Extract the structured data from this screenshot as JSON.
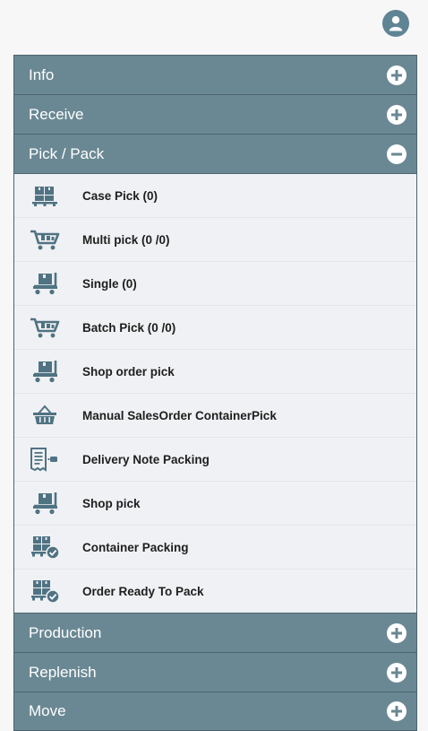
{
  "colors": {
    "header_bg": "#6a8894",
    "icon": "#4f7383",
    "text": "#1e1e1e"
  },
  "user": {
    "icon": "user-avatar-icon"
  },
  "menu": {
    "sections_top": [
      {
        "label": "Info",
        "state": "collapsed"
      },
      {
        "label": "Receive",
        "state": "collapsed"
      },
      {
        "label": "Pick / Pack",
        "state": "expanded"
      }
    ],
    "pick_pack_items": [
      {
        "label": "Case Pick (0)",
        "icon": "pallet-icon"
      },
      {
        "label": "Multi pick (0 /0)",
        "icon": "cart-icon"
      },
      {
        "label": "Single (0)",
        "icon": "trolley-icon"
      },
      {
        "label": "Batch Pick (0 /0)",
        "icon": "cart-icon"
      },
      {
        "label": "Shop order pick",
        "icon": "trolley-icon"
      },
      {
        "label": "Manual SalesOrder ContainerPick",
        "icon": "basket-icon"
      },
      {
        "label": "Delivery Note Packing",
        "icon": "receipt-scan-icon"
      },
      {
        "label": "Shop pick",
        "icon": "trolley-icon"
      },
      {
        "label": "Container Packing",
        "icon": "pallet-check-icon"
      },
      {
        "label": "Order Ready To Pack",
        "icon": "pallet-check-icon"
      }
    ],
    "sections_bottom": [
      {
        "label": "Production",
        "state": "collapsed"
      },
      {
        "label": "Replenish",
        "state": "collapsed"
      },
      {
        "label": "Move",
        "state": "collapsed"
      }
    ]
  }
}
